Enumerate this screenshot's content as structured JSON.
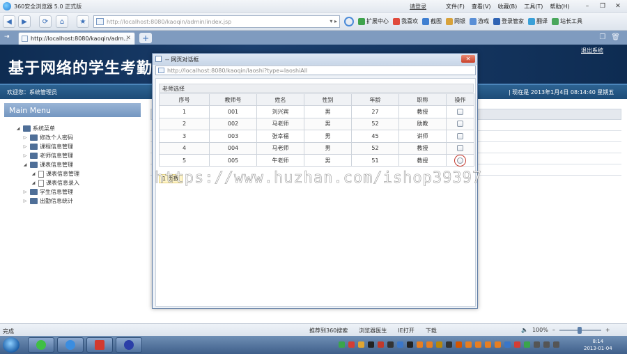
{
  "browser": {
    "title": "360安全浏览器 5.0 正式版",
    "login": "请登录",
    "menu": [
      "文件(F)",
      "查看(V)",
      "收藏(B)",
      "工具(T)",
      "帮助(H)"
    ],
    "address": "http://localhost:8080/kaoqin/admin/index.jsp",
    "toolbar": [
      "扩展中心",
      "我喜欢",
      "截图",
      "网银",
      "游戏",
      "登录管家",
      "翻译",
      "站长工具"
    ],
    "tab": {
      "label": "http://localhost:8080/kaoqin/adm..."
    },
    "status_done": "完成",
    "status_items": [
      "推荐到360搜索",
      "浏览器医生",
      "IE打开",
      "下载"
    ],
    "zoom": "100%"
  },
  "page": {
    "site_title": "基于网络的学生考勤管理",
    "logout": "退出系统",
    "welcome": "欢迎您：系统管理员",
    "now": "| 现在是 2013年1月4日   08:14:40 星期五",
    "main_menu": "Main Menu",
    "tree": [
      {
        "label": "系统菜单",
        "level": 0,
        "type": "folder",
        "arrow": "◢"
      },
      {
        "label": "修改个人密码",
        "level": 1,
        "type": "folder",
        "arrow": "▷"
      },
      {
        "label": "课程信息管理",
        "level": 1,
        "type": "folder",
        "arrow": "▷"
      },
      {
        "label": "老师信息管理",
        "level": 1,
        "type": "folder",
        "arrow": "▷"
      },
      {
        "label": "课表信息管理",
        "level": 1,
        "type": "folder",
        "arrow": "◢"
      },
      {
        "label": "课表信息管理",
        "level": 2,
        "type": "file",
        "arrow": "◢"
      },
      {
        "label": "课表信息录入",
        "level": 2,
        "type": "file",
        "arrow": "◢"
      },
      {
        "label": "学生信息管理",
        "level": 1,
        "type": "folder",
        "arrow": "▷"
      },
      {
        "label": "出勤信息统计",
        "level": 1,
        "type": "folder",
        "arrow": "▷"
      }
    ]
  },
  "dialog": {
    "title": "-- 网页对话框",
    "url": "http://localhost:8080/kaoqin/laoshi?type=laoshiAll",
    "caption": "老师选择",
    "columns": [
      "序号",
      "教师号",
      "姓名",
      "性别",
      "年龄",
      "职称",
      "操作"
    ],
    "rows": [
      [
        "1",
        "001",
        "刘兴宾",
        "男",
        "27",
        "教授"
      ],
      [
        "2",
        "002",
        "马老师",
        "男",
        "52",
        "助教"
      ],
      [
        "3",
        "003",
        "张幸福",
        "男",
        "45",
        "讲师"
      ],
      [
        "4",
        "004",
        "马老师",
        "男",
        "52",
        "教授"
      ],
      [
        "5",
        "005",
        "牛老师",
        "男",
        "51",
        "教授"
      ]
    ],
    "selected_row_index": 4,
    "pager": "1 页数"
  },
  "watermark": "https://www.huzhan.com/ishop39397",
  "clock": {
    "time": "8:14",
    "date": "2013-01-04"
  }
}
